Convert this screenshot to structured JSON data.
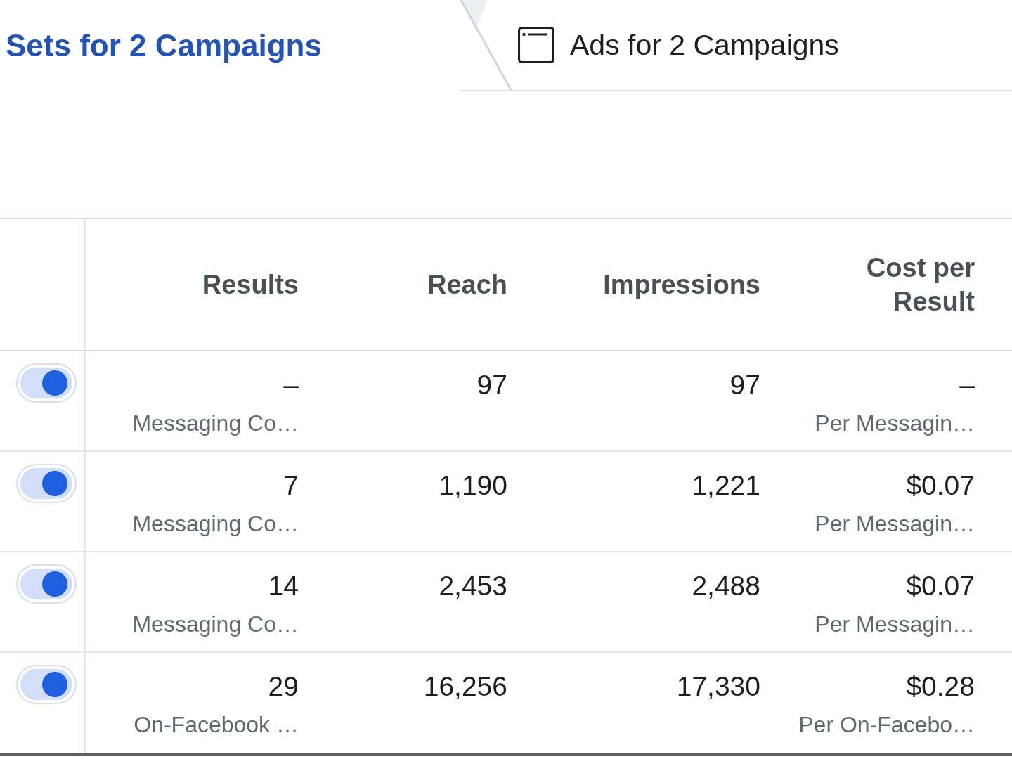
{
  "tabs": [
    {
      "label": "Sets for 2 Campaigns",
      "selected": true
    },
    {
      "label": "Ads for 2 Campaigns",
      "selected": false,
      "icon": true
    }
  ],
  "table": {
    "columns": [
      "Results",
      "Reach",
      "Impressions",
      "Cost per Result"
    ],
    "rows": [
      {
        "on": true,
        "cells": [
          {
            "value": "–",
            "detail": "Messaging Co…"
          },
          {
            "value": "97"
          },
          {
            "value": "97"
          },
          {
            "value": "–",
            "detail": "Per Messagin…"
          }
        ]
      },
      {
        "on": true,
        "cells": [
          {
            "value": "7",
            "detail": "Messaging Co…"
          },
          {
            "value": "1,190"
          },
          {
            "value": "1,221"
          },
          {
            "value": "$0.07",
            "detail": "Per Messagin…"
          }
        ]
      },
      {
        "on": true,
        "cells": [
          {
            "value": "14",
            "detail": "Messaging Co…"
          },
          {
            "value": "2,453"
          },
          {
            "value": "2,488"
          },
          {
            "value": "$0.07",
            "detail": "Per Messagin…"
          }
        ]
      },
      {
        "on": true,
        "cells": [
          {
            "value": "29",
            "detail": "On-Facebook …"
          },
          {
            "value": "16,256"
          },
          {
            "value": "17,330"
          },
          {
            "value": "$0.28",
            "detail": "Per On-Facebo…"
          }
        ]
      }
    ]
  }
}
